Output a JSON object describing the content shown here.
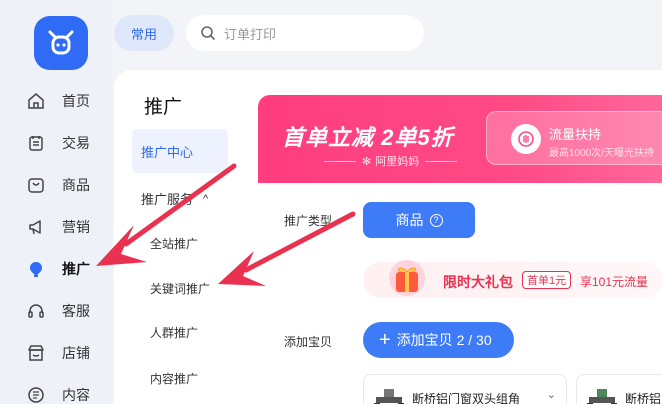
{
  "rail": {
    "items": [
      {
        "label": "首页",
        "icon": "home-icon"
      },
      {
        "label": "交易",
        "icon": "trade-icon"
      },
      {
        "label": "商品",
        "icon": "goods-icon"
      },
      {
        "label": "营销",
        "icon": "megaphone-icon"
      },
      {
        "label": "推广",
        "icon": "promotion-icon",
        "active": true
      },
      {
        "label": "客服",
        "icon": "headset-icon"
      },
      {
        "label": "店铺",
        "icon": "shop-icon"
      },
      {
        "label": "内容",
        "icon": "content-icon"
      }
    ]
  },
  "topbar": {
    "common_label": "常用",
    "search_placeholder": "订单打印"
  },
  "submenu": {
    "title": "推广",
    "active_item": "推广中心",
    "group_label": "推广服务",
    "items": [
      "全站推广",
      "关键词推广",
      "人群推广",
      "内容推广"
    ]
  },
  "banner": {
    "headline": "首单立减 2单5折",
    "sub": "阿里妈妈",
    "card_title": "流量扶持",
    "card_sub": "最高1000次/天曝光扶持"
  },
  "form": {
    "type_label": "推广类型",
    "type_button": "商品",
    "gift_title": "限时大礼包",
    "gift_badge": "首单1元",
    "gift_desc": "享101元流量",
    "add_label": "添加宝贝",
    "add_button": "添加宝贝 2 / 30",
    "products": [
      {
        "name": "断桥铝门窗双头组角"
      },
      {
        "name": "断桥铝"
      }
    ]
  },
  "colors": {
    "brand": "#2f6bf5",
    "banner": "#ff3d7f",
    "annotation": "#e8324f"
  }
}
